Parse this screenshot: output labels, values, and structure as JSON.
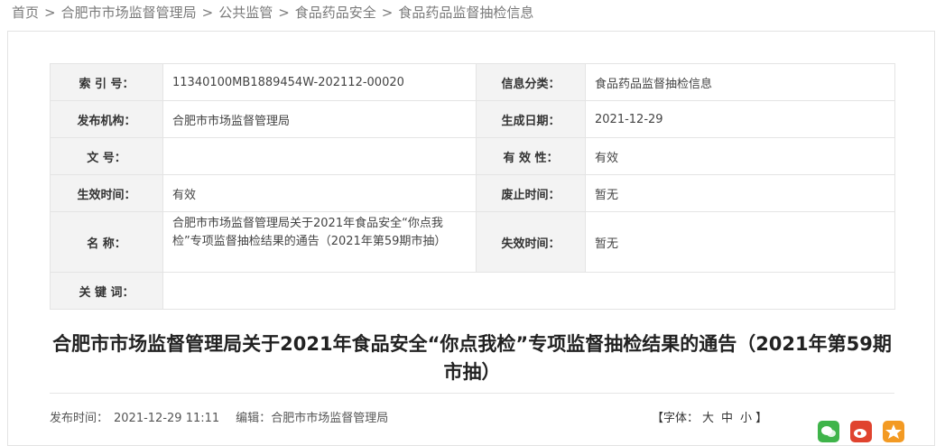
{
  "breadcrumb": {
    "items": [
      "首页",
      "合肥市市场监督管理局",
      "公共监管",
      "食品药品安全",
      "食品药品监督抽检信息"
    ],
    "separator": ">"
  },
  "meta": {
    "index_label": "索 引 号：",
    "index_value": "11340100MB1889454W-202112-00020",
    "category_label": "信息分类：",
    "category_value": "食品药品监督抽检信息",
    "publisher_label": "发布机构：",
    "publisher_value": "合肥市市场监督管理局",
    "created_label": "生成日期：",
    "created_value": "2021-12-29",
    "docno_label": "文 号：",
    "docno_value": "",
    "validity_label": "有 效 性：",
    "validity_value": "有效",
    "effective_label": "生效时间：",
    "effective_value": "有效",
    "repeal_label": "废止时间：",
    "repeal_value": "暂无",
    "name_label": "名 称：",
    "name_value": "合肥市市场监督管理局关于2021年食品安全“你点我检”专项监督抽检结果的通告（2021年第59期市抽）",
    "expire_label": "失效时间：",
    "expire_value": "暂无",
    "keywords_label": "关 键 词：",
    "keywords_value": ""
  },
  "article": {
    "title": "合肥市市场监督管理局关于2021年食品安全“你点我检”专项监督抽检结果的通告（2021年第59期市抽）",
    "publish_label": "发布时间：",
    "publish_time": "2021-12-29 11:11",
    "editor_label": "编辑：",
    "editor_value": "合肥市市场监督管理局",
    "fontsize_label": "【字体：",
    "fontsize_large": "大",
    "fontsize_medium": "中",
    "fontsize_small": "小",
    "fontsize_end": "】"
  },
  "share": {
    "icons": [
      "wechat-icon",
      "weibo-icon",
      "qzone-icon"
    ],
    "colors": {
      "wechat": "#3fb44a",
      "weibo": "#e0432e",
      "qzone": "#f39a23"
    }
  }
}
